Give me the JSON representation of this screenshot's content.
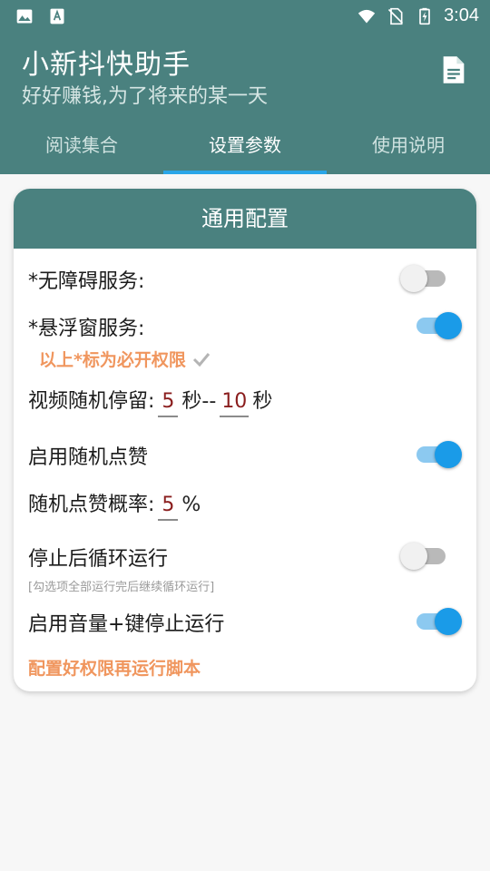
{
  "status_bar": {
    "time": "3:04"
  },
  "app": {
    "title": "小新抖快助手",
    "subtitle": "好好赚钱,为了将来的某一天"
  },
  "tabs": [
    {
      "label": "阅读集合",
      "active": false
    },
    {
      "label": "设置参数",
      "active": true
    },
    {
      "label": "使用说明",
      "active": false
    }
  ],
  "card": {
    "title": "通用配置",
    "accessibility": {
      "label": "*无障碍服务:",
      "enabled": false
    },
    "floating": {
      "label": "*悬浮窗服务:",
      "enabled": true
    },
    "required_note": "以上*标为必开权限",
    "video_stay": {
      "label": "视频随机停留:",
      "min": "5",
      "sep": "秒--",
      "max": "10",
      "unit": "秒"
    },
    "random_like": {
      "label": "启用随机点赞",
      "enabled": true
    },
    "like_rate": {
      "label": "随机点赞概率:",
      "value": "5",
      "unit": "%"
    },
    "loop": {
      "label": "停止后循环运行",
      "hint": "[勾选项全部运行完后继续循环运行]",
      "enabled": false
    },
    "volume_stop": {
      "label": "启用音量+键停止运行",
      "enabled": true
    },
    "footer_note": "配置好权限再运行脚本"
  },
  "colors": {
    "primary": "#4a817f",
    "accent": "#1a9be8",
    "warn": "#f0965e",
    "value": "#8a1d1d"
  },
  "icons": [
    "image-icon",
    "accessibility-app-icon",
    "wifi-icon",
    "no-sim-icon",
    "battery-charging-icon",
    "document-icon",
    "check-icon"
  ]
}
